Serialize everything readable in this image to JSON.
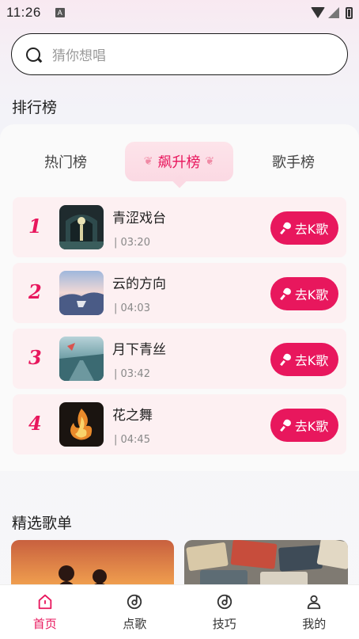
{
  "status": {
    "time": "11:26",
    "indicator": "A"
  },
  "search": {
    "placeholder": "猜你想唱"
  },
  "ranking": {
    "title": "排行榜",
    "tabs": [
      {
        "label": "热门榜",
        "active": false
      },
      {
        "label": "飙升榜",
        "active": true
      },
      {
        "label": "歌手榜",
        "active": false
      }
    ],
    "songs": [
      {
        "rank": "1",
        "title": "青涩戏台",
        "duration": "| 03:20",
        "button": "去K歌"
      },
      {
        "rank": "2",
        "title": "云的方向",
        "duration": "| 04:03",
        "button": "去K歌"
      },
      {
        "rank": "3",
        "title": "月下青丝",
        "duration": "| 03:42",
        "button": "去K歌"
      },
      {
        "rank": "4",
        "title": "花之舞",
        "duration": "| 04:45",
        "button": "去K歌"
      }
    ]
  },
  "playlists": {
    "title": "精选歌单"
  },
  "tabbar": [
    {
      "label": "首页",
      "icon": "home-icon",
      "active": true
    },
    {
      "label": "点歌",
      "icon": "music-disc-icon",
      "active": false
    },
    {
      "label": "技巧",
      "icon": "music-disc-icon",
      "active": false
    },
    {
      "label": "我的",
      "icon": "person-icon",
      "active": false
    }
  ],
  "colors": {
    "accent": "#e8175d",
    "row_bg": "#fdf0f2",
    "tab_active_bg": "#fbd9e3"
  }
}
